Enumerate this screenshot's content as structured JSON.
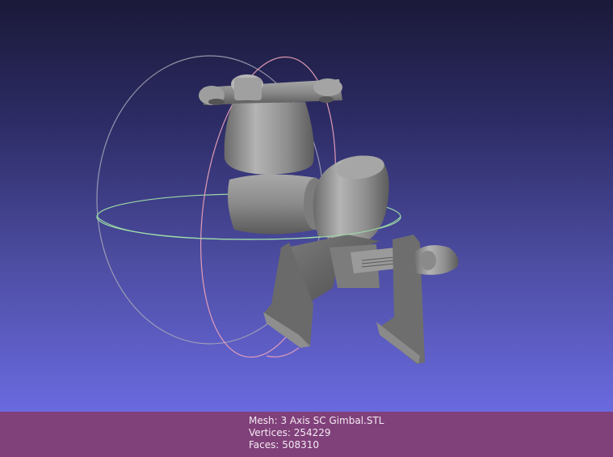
{
  "app": {
    "viewer": "3D mesh viewport"
  },
  "mesh_info": {
    "mesh_line": "Mesh: 3 Axis SC Gimbal.STL",
    "vertices_line": "Vertices: 254229",
    "faces_line": "Faces: 508310"
  },
  "colors": {
    "background_top": "#1a1938",
    "background_bottom": "#6a6ae0",
    "info_bar": "#80407a",
    "trackball_x": "#e8a0b8",
    "trackball_y": "#9fe0a8",
    "trackball_z": "#a8a8b8",
    "mesh": "#8c8c8c"
  },
  "icons": {
    "trackball": "trackball-gizmo-icon"
  }
}
